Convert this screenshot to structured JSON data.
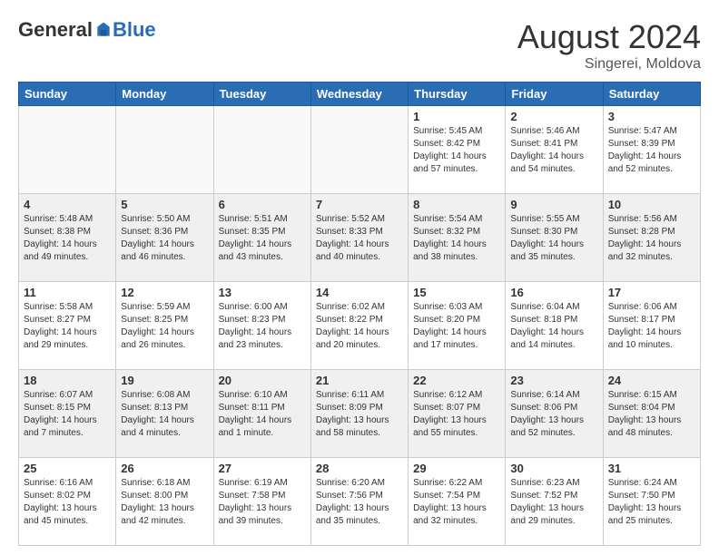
{
  "header": {
    "logo_general": "General",
    "logo_blue": "Blue",
    "month_year": "August 2024",
    "location": "Singerei, Moldova"
  },
  "weekdays": [
    "Sunday",
    "Monday",
    "Tuesday",
    "Wednesday",
    "Thursday",
    "Friday",
    "Saturday"
  ],
  "weeks": [
    [
      {
        "day": "",
        "info": ""
      },
      {
        "day": "",
        "info": ""
      },
      {
        "day": "",
        "info": ""
      },
      {
        "day": "",
        "info": ""
      },
      {
        "day": "1",
        "info": "Sunrise: 5:45 AM\nSunset: 8:42 PM\nDaylight: 14 hours\nand 57 minutes."
      },
      {
        "day": "2",
        "info": "Sunrise: 5:46 AM\nSunset: 8:41 PM\nDaylight: 14 hours\nand 54 minutes."
      },
      {
        "day": "3",
        "info": "Sunrise: 5:47 AM\nSunset: 8:39 PM\nDaylight: 14 hours\nand 52 minutes."
      }
    ],
    [
      {
        "day": "4",
        "info": "Sunrise: 5:48 AM\nSunset: 8:38 PM\nDaylight: 14 hours\nand 49 minutes."
      },
      {
        "day": "5",
        "info": "Sunrise: 5:50 AM\nSunset: 8:36 PM\nDaylight: 14 hours\nand 46 minutes."
      },
      {
        "day": "6",
        "info": "Sunrise: 5:51 AM\nSunset: 8:35 PM\nDaylight: 14 hours\nand 43 minutes."
      },
      {
        "day": "7",
        "info": "Sunrise: 5:52 AM\nSunset: 8:33 PM\nDaylight: 14 hours\nand 40 minutes."
      },
      {
        "day": "8",
        "info": "Sunrise: 5:54 AM\nSunset: 8:32 PM\nDaylight: 14 hours\nand 38 minutes."
      },
      {
        "day": "9",
        "info": "Sunrise: 5:55 AM\nSunset: 8:30 PM\nDaylight: 14 hours\nand 35 minutes."
      },
      {
        "day": "10",
        "info": "Sunrise: 5:56 AM\nSunset: 8:28 PM\nDaylight: 14 hours\nand 32 minutes."
      }
    ],
    [
      {
        "day": "11",
        "info": "Sunrise: 5:58 AM\nSunset: 8:27 PM\nDaylight: 14 hours\nand 29 minutes."
      },
      {
        "day": "12",
        "info": "Sunrise: 5:59 AM\nSunset: 8:25 PM\nDaylight: 14 hours\nand 26 minutes."
      },
      {
        "day": "13",
        "info": "Sunrise: 6:00 AM\nSunset: 8:23 PM\nDaylight: 14 hours\nand 23 minutes."
      },
      {
        "day": "14",
        "info": "Sunrise: 6:02 AM\nSunset: 8:22 PM\nDaylight: 14 hours\nand 20 minutes."
      },
      {
        "day": "15",
        "info": "Sunrise: 6:03 AM\nSunset: 8:20 PM\nDaylight: 14 hours\nand 17 minutes."
      },
      {
        "day": "16",
        "info": "Sunrise: 6:04 AM\nSunset: 8:18 PM\nDaylight: 14 hours\nand 14 minutes."
      },
      {
        "day": "17",
        "info": "Sunrise: 6:06 AM\nSunset: 8:17 PM\nDaylight: 14 hours\nand 10 minutes."
      }
    ],
    [
      {
        "day": "18",
        "info": "Sunrise: 6:07 AM\nSunset: 8:15 PM\nDaylight: 14 hours\nand 7 minutes."
      },
      {
        "day": "19",
        "info": "Sunrise: 6:08 AM\nSunset: 8:13 PM\nDaylight: 14 hours\nand 4 minutes."
      },
      {
        "day": "20",
        "info": "Sunrise: 6:10 AM\nSunset: 8:11 PM\nDaylight: 14 hours\nand 1 minute."
      },
      {
        "day": "21",
        "info": "Sunrise: 6:11 AM\nSunset: 8:09 PM\nDaylight: 13 hours\nand 58 minutes."
      },
      {
        "day": "22",
        "info": "Sunrise: 6:12 AM\nSunset: 8:07 PM\nDaylight: 13 hours\nand 55 minutes."
      },
      {
        "day": "23",
        "info": "Sunrise: 6:14 AM\nSunset: 8:06 PM\nDaylight: 13 hours\nand 52 minutes."
      },
      {
        "day": "24",
        "info": "Sunrise: 6:15 AM\nSunset: 8:04 PM\nDaylight: 13 hours\nand 48 minutes."
      }
    ],
    [
      {
        "day": "25",
        "info": "Sunrise: 6:16 AM\nSunset: 8:02 PM\nDaylight: 13 hours\nand 45 minutes."
      },
      {
        "day": "26",
        "info": "Sunrise: 6:18 AM\nSunset: 8:00 PM\nDaylight: 13 hours\nand 42 minutes."
      },
      {
        "day": "27",
        "info": "Sunrise: 6:19 AM\nSunset: 7:58 PM\nDaylight: 13 hours\nand 39 minutes."
      },
      {
        "day": "28",
        "info": "Sunrise: 6:20 AM\nSunset: 7:56 PM\nDaylight: 13 hours\nand 35 minutes."
      },
      {
        "day": "29",
        "info": "Sunrise: 6:22 AM\nSunset: 7:54 PM\nDaylight: 13 hours\nand 32 minutes."
      },
      {
        "day": "30",
        "info": "Sunrise: 6:23 AM\nSunset: 7:52 PM\nDaylight: 13 hours\nand 29 minutes."
      },
      {
        "day": "31",
        "info": "Sunrise: 6:24 AM\nSunset: 7:50 PM\nDaylight: 13 hours\nand 25 minutes."
      }
    ]
  ]
}
